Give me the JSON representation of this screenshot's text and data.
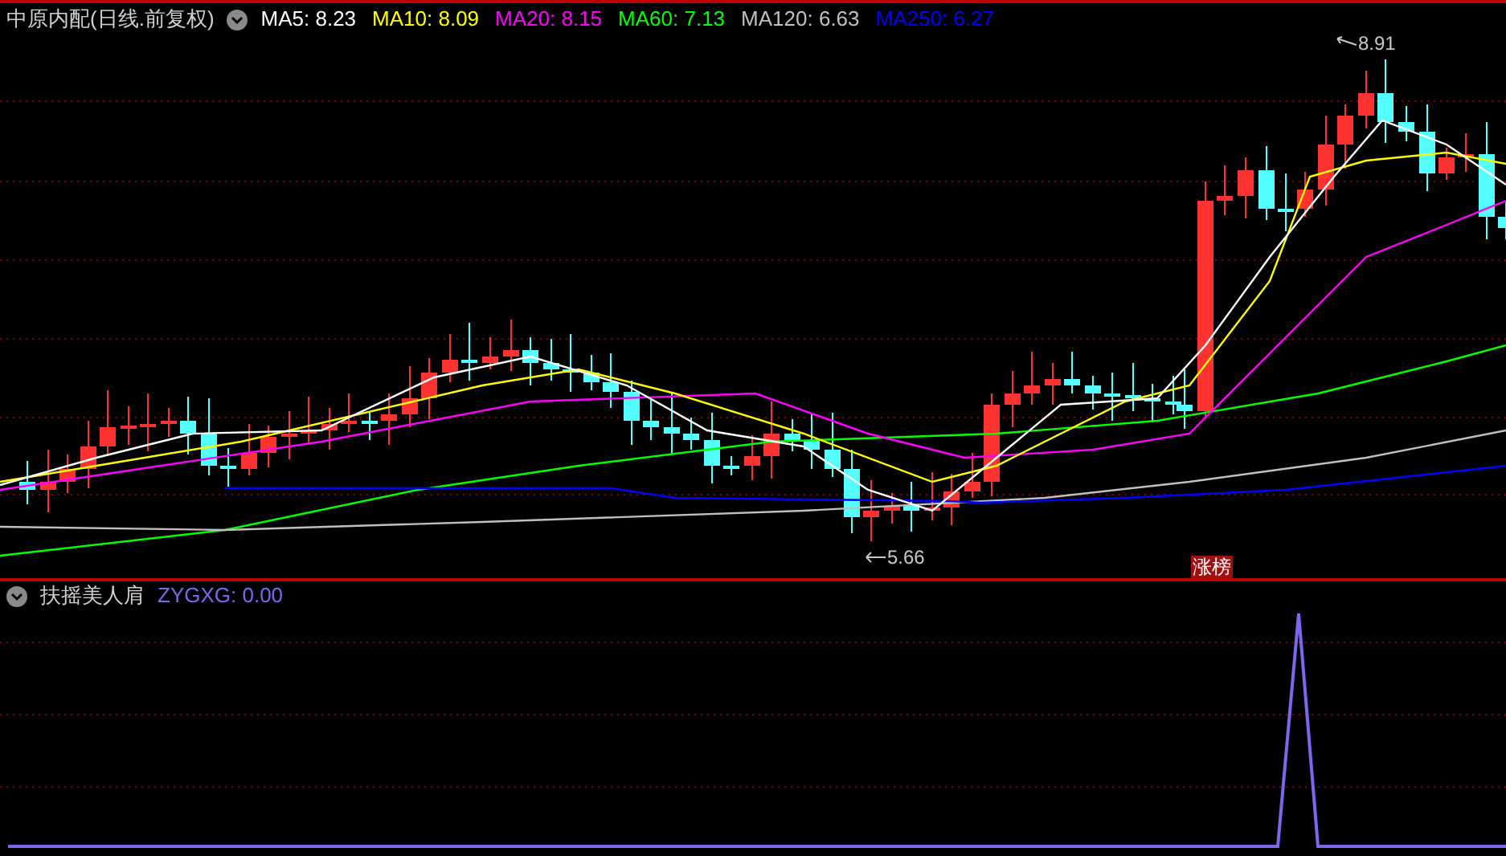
{
  "main_panel": {
    "title": "中原内配(日线.前复权)",
    "indicators": [
      {
        "label": "MA5: 8.23",
        "color": "#ffffff"
      },
      {
        "label": "MA10: 8.09",
        "color": "#ffff00"
      },
      {
        "label": "MA20: 8.15",
        "color": "#ff00ff"
      },
      {
        "label": "MA60: 7.13",
        "color": "#00ff00"
      },
      {
        "label": "MA120: 6.63",
        "color": "#c0c0c0"
      },
      {
        "label": "MA250: 6.27",
        "color": "#0000ff"
      }
    ],
    "high_label": "8.91",
    "low_label": "5.66",
    "badge": "涨榜"
  },
  "sub_panel": {
    "title": "扶摇美人肩",
    "indicators": [
      {
        "label": "ZYGXG: 0.00",
        "color": "#7b68ee"
      }
    ]
  }
}
